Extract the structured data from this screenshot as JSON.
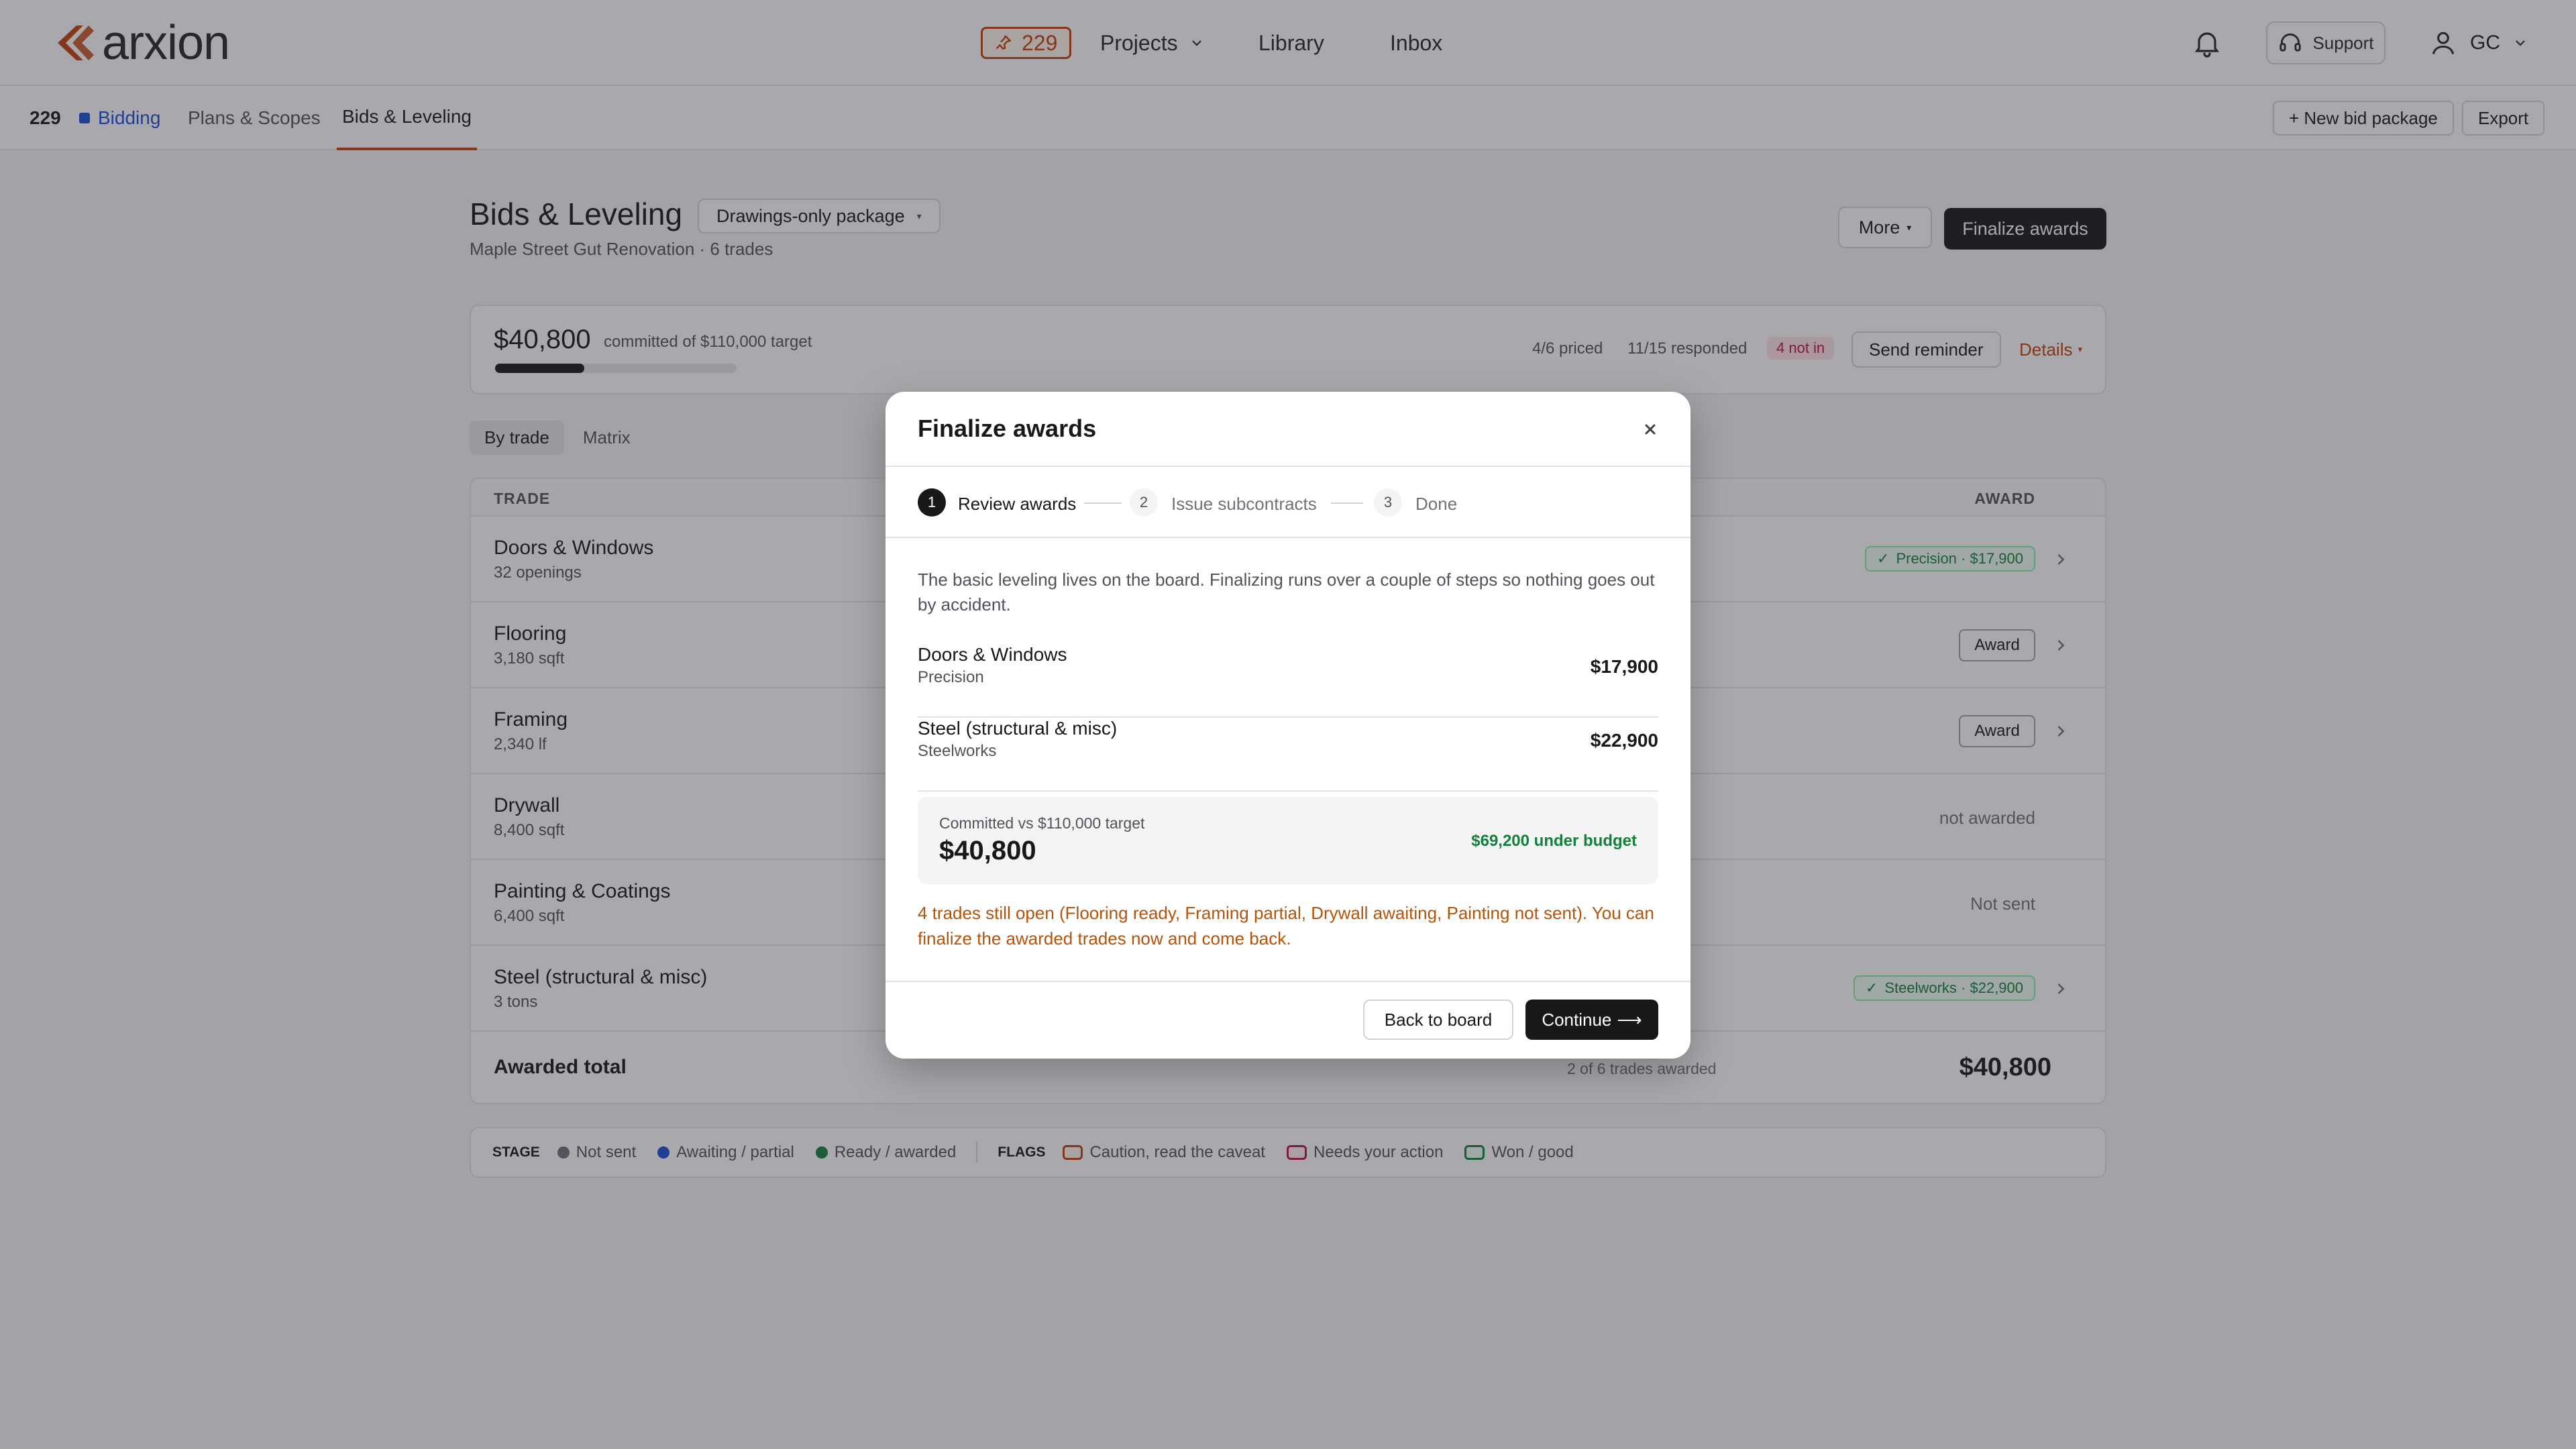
{
  "nav": {
    "logo": "arxion",
    "pin_count": "229",
    "links": [
      "Projects",
      "Library",
      "Inbox"
    ],
    "support": "Support",
    "user": "GC"
  },
  "subnav": {
    "project_id": "229",
    "status": "Bidding",
    "tabs": [
      "Plans & Scopes",
      "Bids & Leveling"
    ],
    "new_package": "+ New bid package",
    "export": "Export"
  },
  "header": {
    "title": "Bids & Leveling",
    "package": "Drawings-only package",
    "subtitle": "Maple Street Gut Renovation · 6 trades",
    "more": "More",
    "finalize": "Finalize awards"
  },
  "summary": {
    "committed": "$40,800",
    "committed_note": "committed of $110,000 target",
    "progress": 0.37,
    "priced": "4/6 priced",
    "responded": "11/15 responded",
    "not_in": "4 not in",
    "send_reminder": "Send reminder",
    "details": "Details"
  },
  "view_toggle": [
    "By trade",
    "Matrix"
  ],
  "table": {
    "col_trade": "TRADE",
    "col_award": "AWARD",
    "rows": [
      {
        "name": "Doors & Windows",
        "sub": "32 openings",
        "award": "Precision · $17,900"
      },
      {
        "name": "Flooring",
        "sub": "3,180 sqft",
        "award": "Award",
        "flag": "lit"
      },
      {
        "name": "Framing",
        "sub": "2,340 lf",
        "award": "Award"
      },
      {
        "name": "Drywall",
        "sub": "8,400 sqft",
        "award": "not awarded"
      },
      {
        "name": "Painting & Coatings",
        "sub": "6,400 sqft",
        "award": "Not sent"
      },
      {
        "name": "Steel (structural & misc)",
        "sub": "3 tons",
        "award": "Steelworks · $22,900"
      }
    ],
    "total_label": "Awarded total",
    "total_note": "2 of 6 trades awarded",
    "total_value": "$40,800"
  },
  "legend": {
    "stage_label": "STAGE",
    "stages": [
      {
        "label": "Not sent",
        "color": "#71717a"
      },
      {
        "label": "Awaiting / partial",
        "color": "#1d4ed8"
      },
      {
        "label": "Ready / awarded",
        "color": "#15803d"
      }
    ],
    "flags_label": "FLAGS",
    "flags": [
      {
        "label": "Caution, read the caveat",
        "color": "#c2410c"
      },
      {
        "label": "Needs your action",
        "color": "#be123c"
      },
      {
        "label": "Won / good",
        "color": "#15803d"
      }
    ]
  },
  "modal": {
    "title": "Finalize awards",
    "steps": [
      "Review awards",
      "Issue subcontracts",
      "Done"
    ],
    "step_numbers": [
      "1",
      "2",
      "3"
    ],
    "intro": "The basic leveling lives on the board. Finalizing runs over a couple of steps so nothing goes out by accident.",
    "items": [
      {
        "name": "Doors & Windows",
        "sub": "Precision",
        "amount": "$17,900"
      },
      {
        "name": "Steel (structural & misc)",
        "sub": "Steelworks",
        "amount": "$22,900"
      }
    ],
    "total_caption": "Committed vs $110,000 target",
    "total_value": "$40,800",
    "under_budget": "$69,200 under budget",
    "warning": "4 trades still open (Flooring ready, Framing partial, Drywall awaiting, Painting not sent). You can finalize the awarded trades now and come back.",
    "back": "Back to board",
    "continue": "Continue",
    "continue_arrow": "⟶"
  }
}
